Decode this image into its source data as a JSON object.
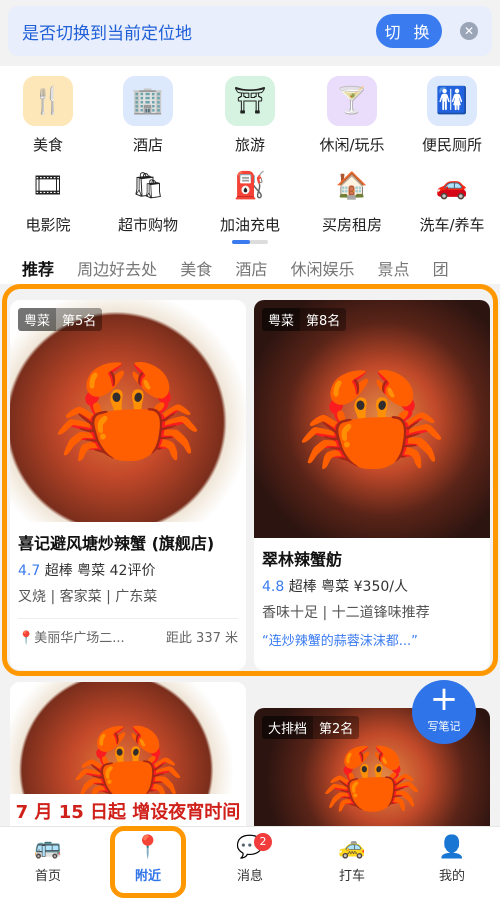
{
  "banner": {
    "text": "是否切换到当前定位地",
    "switch_label": "切 换",
    "close_icon": "close-icon"
  },
  "categories": [
    {
      "label": "美食",
      "icon": "fork-knife-icon",
      "glyph": "🍴",
      "color": "#fde7b8"
    },
    {
      "label": "酒店",
      "icon": "hotel-icon",
      "glyph": "🏢",
      "color": "#dce8fb"
    },
    {
      "label": "旅游",
      "icon": "gate-icon",
      "glyph": "⛩",
      "color": "#d6f3e2"
    },
    {
      "label": "休闲/玩乐",
      "icon": "cocktail-icon",
      "glyph": "🍸",
      "color": "#eadcfb"
    },
    {
      "label": "便民厕所",
      "icon": "restroom-icon",
      "glyph": "🚻",
      "color": "#dce8fb"
    },
    {
      "label": "电影院",
      "icon": "film-icon",
      "glyph": "🎞",
      "color": "#ffffff"
    },
    {
      "label": "超市购物",
      "icon": "shopping-bag-icon",
      "glyph": "🛍",
      "color": "#ffffff"
    },
    {
      "label": "加油充电",
      "icon": "fuel-icon",
      "glyph": "⛽",
      "color": "#ffffff"
    },
    {
      "label": "买房租房",
      "icon": "house-icon",
      "glyph": "🏠",
      "color": "#ffffff"
    },
    {
      "label": "洗车/养车",
      "icon": "car-icon",
      "glyph": "🚗",
      "color": "#ffffff"
    }
  ],
  "tabs": [
    "推荐",
    "周边好去处",
    "美食",
    "酒店",
    "休闲娱乐",
    "景点",
    "团"
  ],
  "cards": [
    {
      "category": "粤菜",
      "rank": "第5名",
      "title": "喜记避风塘炒辣蟹 (旗舰店)",
      "score": "4.7",
      "level": "超棒",
      "cuisine": "粤菜",
      "extra": "42评价",
      "tags": "叉烧 | 客家菜 | 广东菜",
      "location": "美丽华广场二...",
      "distance": "距此 337 米"
    },
    {
      "category": "粤菜",
      "rank": "第8名",
      "title": "翠林辣蟹舫",
      "score": "4.8",
      "level": "超棒",
      "cuisine": "粤菜",
      "extra": "¥350/人",
      "tags": "香味十足 | 十二道锋味推荐",
      "quote": "“连炒辣蟹的蒜蓉沫沫都...”"
    }
  ],
  "lower_cards": [
    {
      "promo": "7 月 15 日起 增设夜宵时间"
    },
    {
      "category": "大排档",
      "rank": "第2名"
    }
  ],
  "fab": {
    "label": "写笔记"
  },
  "bottom_nav": [
    {
      "label": "首页",
      "icon": "bus-icon",
      "glyph": "🚌"
    },
    {
      "label": "附近",
      "icon": "location-pin-icon",
      "glyph": "📍"
    },
    {
      "label": "消息",
      "icon": "message-icon",
      "glyph": "💬",
      "badge": "2"
    },
    {
      "label": "打车",
      "icon": "taxi-icon",
      "glyph": "🚕"
    },
    {
      "label": "我的",
      "icon": "profile-icon",
      "glyph": "👤"
    }
  ]
}
